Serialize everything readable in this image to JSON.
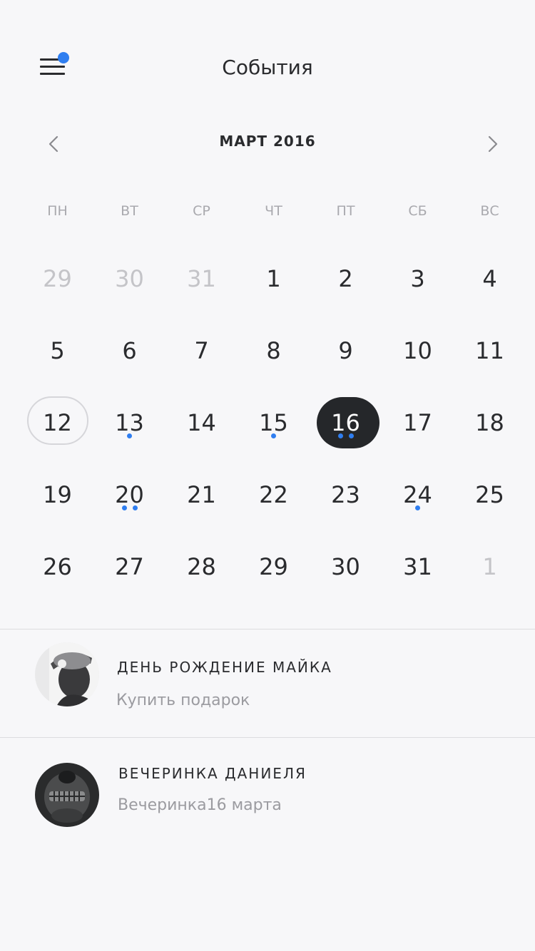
{
  "header": {
    "title": "События",
    "menu_icon": "hamburger-menu-icon",
    "notification_color": "#2f7ef0"
  },
  "calendar": {
    "month_label": "МАРТ 2016",
    "prev_icon": "chevron-left-icon",
    "next_icon": "chevron-right-icon",
    "weekdays": [
      "ПН",
      "ВТ",
      "СР",
      "ЧТ",
      "ПТ",
      "СБ",
      "ВС"
    ],
    "weeks": [
      [
        {
          "day": "29",
          "muted": true,
          "dots": 0
        },
        {
          "day": "30",
          "muted": true,
          "dots": 0
        },
        {
          "day": "31",
          "muted": true,
          "dots": 0
        },
        {
          "day": "1",
          "muted": false,
          "dots": 0
        },
        {
          "day": "2",
          "muted": false,
          "dots": 0
        },
        {
          "day": "3",
          "muted": false,
          "dots": 0
        },
        {
          "day": "4",
          "muted": false,
          "dots": 0
        }
      ],
      [
        {
          "day": "5",
          "muted": false,
          "dots": 0
        },
        {
          "day": "6",
          "muted": false,
          "dots": 0
        },
        {
          "day": "7",
          "muted": false,
          "dots": 0
        },
        {
          "day": "8",
          "muted": false,
          "dots": 0
        },
        {
          "day": "9",
          "muted": false,
          "dots": 0
        },
        {
          "day": "10",
          "muted": false,
          "dots": 0
        },
        {
          "day": "11",
          "muted": false,
          "dots": 0
        }
      ],
      [
        {
          "day": "12",
          "muted": false,
          "dots": 0,
          "today": true
        },
        {
          "day": "13",
          "muted": false,
          "dots": 1
        },
        {
          "day": "14",
          "muted": false,
          "dots": 0
        },
        {
          "day": "15",
          "muted": false,
          "dots": 1
        },
        {
          "day": "16",
          "muted": false,
          "dots": 2,
          "selected": true
        },
        {
          "day": "17",
          "muted": false,
          "dots": 0
        },
        {
          "day": "18",
          "muted": false,
          "dots": 0
        }
      ],
      [
        {
          "day": "19",
          "muted": false,
          "dots": 0
        },
        {
          "day": "20",
          "muted": false,
          "dots": 2
        },
        {
          "day": "21",
          "muted": false,
          "dots": 0
        },
        {
          "day": "22",
          "muted": false,
          "dots": 0
        },
        {
          "day": "23",
          "muted": false,
          "dots": 0
        },
        {
          "day": "24",
          "muted": false,
          "dots": 1
        },
        {
          "day": "25",
          "muted": false,
          "dots": 0
        }
      ],
      [
        {
          "day": "26",
          "muted": false,
          "dots": 0
        },
        {
          "day": "27",
          "muted": false,
          "dots": 0
        },
        {
          "day": "28",
          "muted": false,
          "dots": 0
        },
        {
          "day": "29",
          "muted": false,
          "dots": 0
        },
        {
          "day": "30",
          "muted": false,
          "dots": 0
        },
        {
          "day": "31",
          "muted": false,
          "dots": 0
        },
        {
          "day": "1",
          "muted": true,
          "dots": 0
        }
      ]
    ],
    "colors": {
      "event_dot": "#2f7ef0",
      "selected_bg": "#25272a",
      "today_border": "#d6d6da",
      "muted_text": "#c4c4c8"
    }
  },
  "events": [
    {
      "title": "ДЕНЬ РОЖДЕНИЕ МАЙКА",
      "subtitle": "Купить подарок",
      "avatar": "person-avatar"
    },
    {
      "title": "ВЕЧЕРИНКА ДАНИЕЛЯ",
      "subtitle": "Вечеринка16 марта",
      "avatar": "skull-face-avatar"
    }
  ]
}
